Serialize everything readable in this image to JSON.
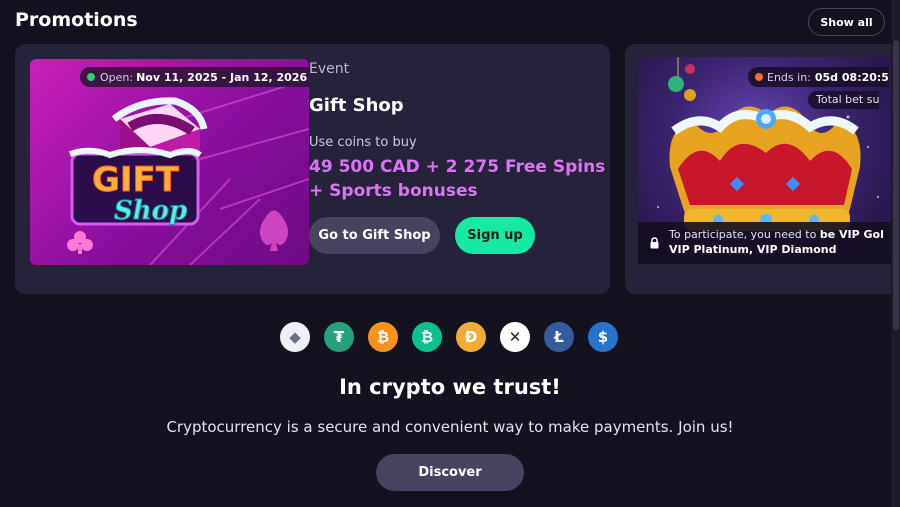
{
  "promotions": {
    "title": "Promotions",
    "show_all_label": "Show all"
  },
  "gift_card": {
    "status_label": "Open:",
    "dates": "Nov 11, 2025 - Jan 12, 2026",
    "logo_text_1": "GIFT",
    "logo_text_2": "Shop",
    "event_label": "Event",
    "title": "Gift Shop",
    "buy_label": "Use coins to buy",
    "prize_line_1": "49 500 CAD + 2 275 Free Spins",
    "prize_line_2": "+ Sports bonuses",
    "go_button_label": "Go to Gift Shop",
    "signup_button_label": "Sign up",
    "status_color": "#2ed36a",
    "accent_color": "#d975f5",
    "signup_color": "#16e9a3"
  },
  "vip_card": {
    "ends_label": "Ends in:",
    "ends_time": "05d 08:20:5",
    "total_bet_text": "Total bet su",
    "lock_text_prefix": "To participate, you need to ",
    "lock_text_bold": "be VIP Gol",
    "lock_text_line2": "VIP Platinum, VIP Diamond",
    "ends_color": "#ff6a2a"
  },
  "crypto": {
    "coins": [
      {
        "name": "ethereum-icon",
        "glyph": "◆",
        "bg": "#eef0f6",
        "fg": "#6c7285"
      },
      {
        "name": "tether-icon",
        "glyph": "₮",
        "bg": "#26a17b",
        "fg": "#ffffff"
      },
      {
        "name": "bitcoin-icon",
        "glyph": "₿",
        "bg": "#f7931a",
        "fg": "#ffffff"
      },
      {
        "name": "bitcoin-cash-icon",
        "glyph": "₿",
        "bg": "#0ac18e",
        "fg": "#ffffff"
      },
      {
        "name": "dai-icon",
        "glyph": "Ð",
        "bg": "#f5ac37",
        "fg": "#ffffff"
      },
      {
        "name": "xrp-icon",
        "glyph": "✕",
        "bg": "#ffffff",
        "fg": "#23292f"
      },
      {
        "name": "litecoin-icon",
        "glyph": "Ł",
        "bg": "#345d9d",
        "fg": "#ffffff"
      },
      {
        "name": "usdc-icon",
        "glyph": "$",
        "bg": "#2775ca",
        "fg": "#ffffff"
      }
    ],
    "headline": "In crypto we trust!",
    "subline": "Cryptocurrency is a secure and convenient way to make payments. Join us!",
    "discover_label": "Discover"
  }
}
